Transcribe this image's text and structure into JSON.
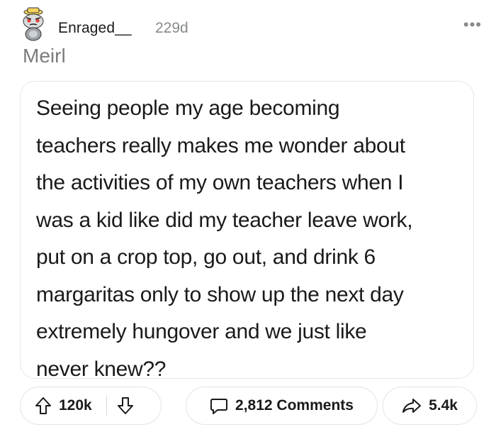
{
  "post": {
    "author": "Enraged__",
    "age": "229d",
    "title": "Meirl",
    "body_lines": [
      "Seeing people my age becoming",
      "teachers really makes me wonder about",
      "the activities of my own teachers when I",
      "was a kid like did my teacher leave work,",
      "put on a crop top, go out, and drink 6",
      "margaritas only to show up the next day",
      "extremely hungover and we just like",
      "never knew??"
    ]
  },
  "actions": {
    "upvotes": "120k",
    "comments_label": "2,812 Comments",
    "shares": "5.4k"
  },
  "icons": {
    "avatar": "snoo-avatar-icon",
    "more": "more-options-icon",
    "upvote": "upvote-arrow-icon",
    "downvote": "downvote-arrow-icon",
    "comment": "comment-bubble-icon",
    "share": "share-arrow-icon"
  },
  "colors": {
    "text": "#1a1a1b",
    "muted": "#878a8c",
    "border": "#e4e6e8"
  }
}
